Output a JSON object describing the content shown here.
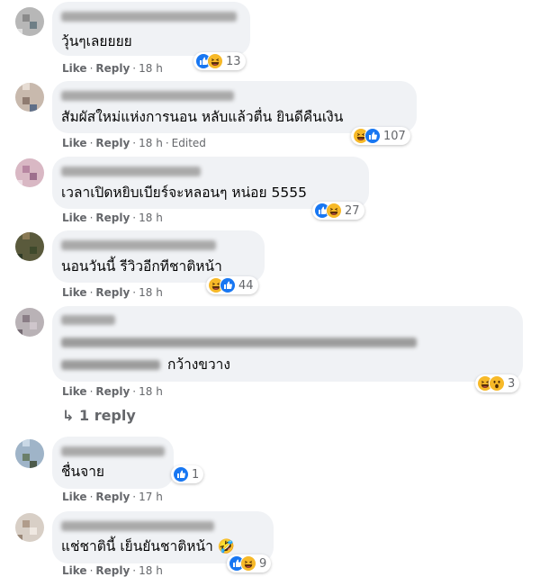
{
  "comments": [
    {
      "text": "วุ้นๆเลยยยย",
      "actions": {
        "like": "Like",
        "reply": "Reply",
        "time": "18 h",
        "edited": ""
      },
      "reactions": [
        "like",
        "haha"
      ],
      "count": "13"
    },
    {
      "text": "สัมผัสใหม่แห่งการนอน หลับแล้วตื่น ยินดีคืนเงิน",
      "actions": {
        "like": "Like",
        "reply": "Reply",
        "time": "18 h",
        "edited": "Edited"
      },
      "reactions": [
        "haha",
        "like"
      ],
      "count": "107"
    },
    {
      "text": "เวลาเปิดหยิบเบียร์จะหลอนๆ หน่อย 5555",
      "actions": {
        "like": "Like",
        "reply": "Reply",
        "time": "18 h",
        "edited": ""
      },
      "reactions": [
        "like",
        "haha"
      ],
      "count": "27"
    },
    {
      "text": "นอนวันนี้ รีวิวอีกทีชาติหน้า",
      "actions": {
        "like": "Like",
        "reply": "Reply",
        "time": "18 h",
        "edited": ""
      },
      "reactions": [
        "haha",
        "like"
      ],
      "count": "44"
    },
    {
      "text": "กว้างขวาง",
      "actions": {
        "like": "Like",
        "reply": "Reply",
        "time": "18 h",
        "edited": ""
      },
      "reactions": [
        "haha",
        "wow"
      ],
      "count": "3"
    },
    {
      "text": "ชื่นจาย",
      "actions": {
        "like": "Like",
        "reply": "Reply",
        "time": "17 h",
        "edited": ""
      },
      "reactions": [
        "like"
      ],
      "count": "1"
    },
    {
      "text": "แช่ชาตินี้ เย็นยันชาติหน้า 🤣",
      "actions": {
        "like": "Like",
        "reply": "Reply",
        "time": "18 h",
        "edited": ""
      },
      "reactions": [
        "like",
        "haha"
      ],
      "count": "9"
    }
  ],
  "replies_link": {
    "arrow": "↳",
    "label": "1 reply"
  },
  "colors": {
    "bubble": "#f0f2f5",
    "meta": "#65676b",
    "like_blue": "#1877f2",
    "haha_yellow": "#f7b928"
  },
  "icons": [
    "like-reaction-icon",
    "haha-reaction-icon",
    "wow-reaction-icon",
    "reply-arrow-icon"
  ]
}
